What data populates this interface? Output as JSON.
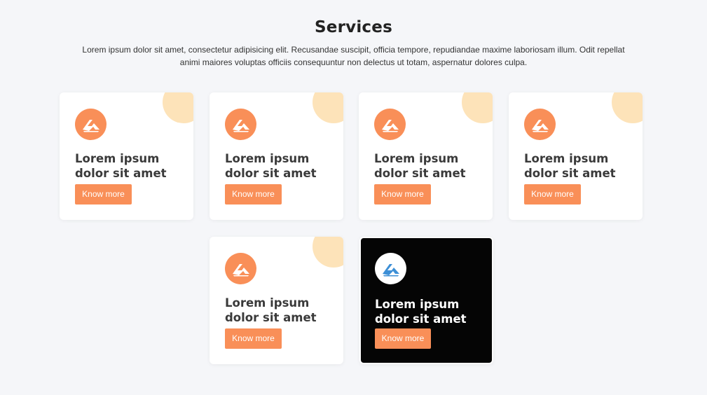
{
  "section": {
    "title": "Services",
    "intro": "Lorem ipsum dolor sit amet, consectetur adipisicing elit. Recusandae suscipit, officia tempore, repudiandae maxime laboriosam illum. Odit repellat animi maiores voluptas officiis consequuntur non delectus ut totam, aspernatur dolores culpa."
  },
  "cards": [
    {
      "heading": "Lorem ipsum dolor sit amet",
      "button": "Know more",
      "icon": "logo-icon"
    },
    {
      "heading": "Lorem ipsum dolor sit amet",
      "button": "Know more",
      "icon": "logo-icon"
    },
    {
      "heading": "Lorem ipsum dolor sit amet",
      "button": "Know more",
      "icon": "logo-icon"
    },
    {
      "heading": "Lorem ipsum dolor sit amet",
      "button": "Know more",
      "icon": "logo-icon"
    },
    {
      "heading": "Lorem ipsum dolor sit amet",
      "button": "Know more",
      "icon": "logo-icon"
    },
    {
      "heading": "Lorem ipsum dolor sit amet",
      "button": "Know more",
      "icon": "logo-icon",
      "active": true
    }
  ],
  "colors": {
    "accent": "#f98f58",
    "corner": "#fde3b9",
    "active_card": "#050505",
    "active_icon": "#3d8fd6",
    "background": "#f5f6f9"
  }
}
